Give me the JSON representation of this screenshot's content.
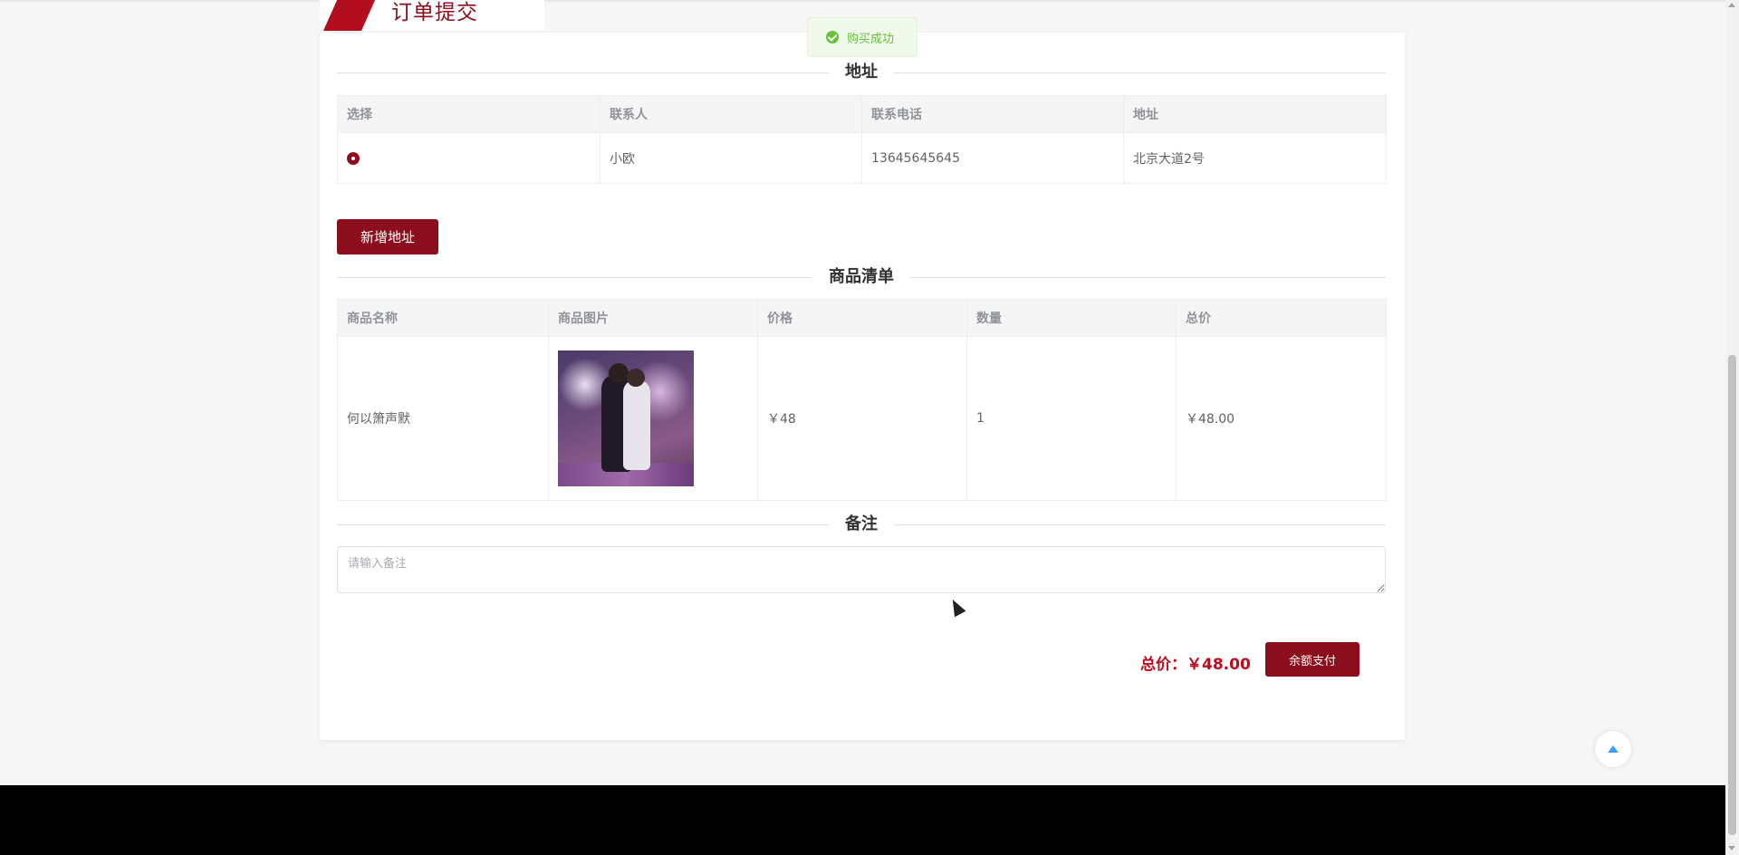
{
  "page": {
    "title": "订单提交"
  },
  "toast": {
    "message": "购买成功",
    "icon": "success-check-icon",
    "color": "#67c23a"
  },
  "address_section": {
    "heading": "地址",
    "columns": [
      "选择",
      "联系人",
      "联系电话",
      "地址"
    ],
    "rows": [
      {
        "selected": true,
        "contact": "小欧",
        "phone": "13645645645",
        "address": "北京大道2号"
      }
    ],
    "add_button": "新增地址"
  },
  "product_section": {
    "heading": "商品清单",
    "columns": [
      "商品名称",
      "商品图片",
      "价格",
      "数量",
      "总价"
    ],
    "rows": [
      {
        "name": "何以箫声默",
        "price": "￥48",
        "quantity": "1",
        "total": "￥48.00"
      }
    ]
  },
  "remark_section": {
    "heading": "备注",
    "placeholder": "请输入备注",
    "value": ""
  },
  "checkout": {
    "total_label": "总价：",
    "total_value": "￥48.00",
    "pay_button": "余额支付"
  },
  "colors": {
    "brand": "#8c0e1c",
    "price": "#c00b1c"
  }
}
